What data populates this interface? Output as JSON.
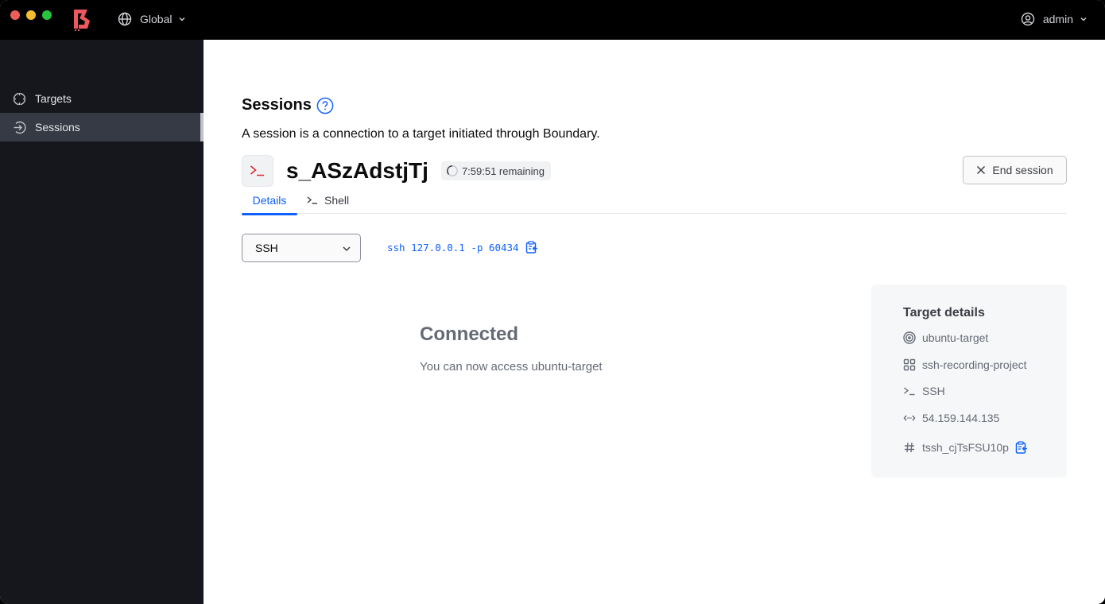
{
  "titlebar": {
    "scope_label": "Global",
    "user_label": "admin"
  },
  "sidebar": {
    "items": [
      {
        "label": "Targets",
        "icon": "target-icon",
        "active": false
      },
      {
        "label": "Sessions",
        "icon": "sessions-icon",
        "active": true
      }
    ]
  },
  "page": {
    "title": "Sessions",
    "description": "A session is a connection to a target initiated through Boundary."
  },
  "session": {
    "id": "s_ASzAdstjTj",
    "remaining": "7:59:51 remaining",
    "end_button": "End session"
  },
  "tabs": [
    {
      "label": "Details",
      "active": true
    },
    {
      "label": "Shell",
      "active": false
    }
  ],
  "connection": {
    "protocol_selected": "SSH",
    "command": "ssh 127.0.0.1 -p 60434"
  },
  "status": {
    "title": "Connected",
    "message": "You can now access ubuntu-target"
  },
  "target_details": {
    "title": "Target details",
    "name": "ubuntu-target",
    "project": "ssh-recording-project",
    "type": "SSH",
    "address": "54.159.144.135",
    "id": "tssh_cjTsFSU10p"
  },
  "colors": {
    "accent": "#1060ff",
    "brand": "#ec585d",
    "sidebar_bg": "#16171c",
    "sidebar_active": "#363a44"
  }
}
